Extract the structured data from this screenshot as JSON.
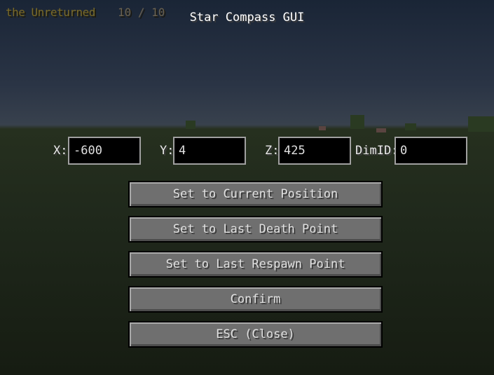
{
  "hud": {
    "name": "the Unreturned",
    "count": "10 / 10"
  },
  "gui": {
    "title": "Star Compass GUI"
  },
  "coords": {
    "x_label": "X:",
    "x_value": "-600",
    "y_label": "Y:",
    "y_value": "4",
    "z_label": "Z:",
    "z_value": "425",
    "dim_label": "DimID:",
    "dim_value": "0"
  },
  "buttons": {
    "current": "Set to Current Position",
    "death": "Set to Last Death Point",
    "respawn": "Set to Last Respawn Point",
    "confirm": "Confirm",
    "close": "ESC (Close)"
  }
}
